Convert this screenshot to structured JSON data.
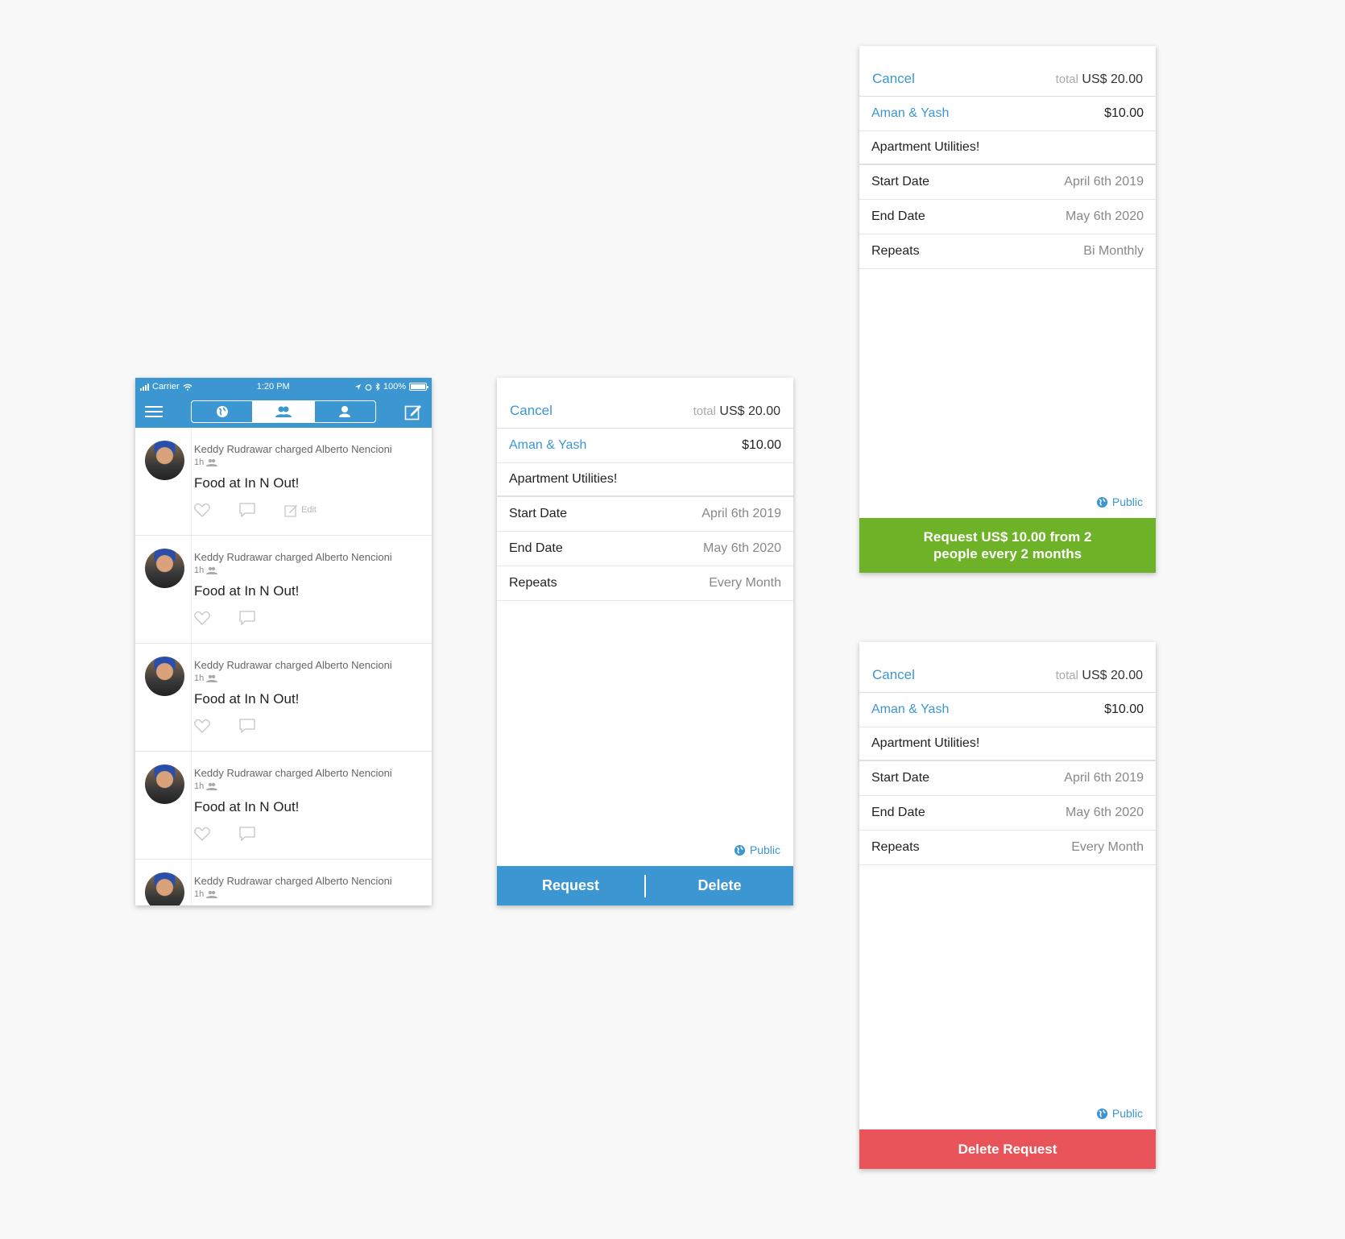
{
  "feed_screen": {
    "status_bar": {
      "carrier": "Carrier",
      "time": "1:20 PM",
      "battery": "100%"
    },
    "tabs": [
      {
        "icon": "globe-icon",
        "active": false
      },
      {
        "icon": "friends-icon",
        "active": true
      },
      {
        "icon": "person-icon",
        "active": false
      }
    ],
    "items": [
      {
        "meta": "Keddy Rudrawar charged Alberto Nencioni",
        "time": "1h",
        "title": "Food at In N Out!",
        "edit": "Edit"
      },
      {
        "meta": "Keddy Rudrawar charged Alberto Nencioni",
        "time": "1h",
        "title": "Food at In N Out!"
      },
      {
        "meta": "Keddy Rudrawar charged Alberto Nencioni",
        "time": "1h",
        "title": "Food at In N Out!"
      },
      {
        "meta": "Keddy Rudrawar charged Alberto Nencioni",
        "time": "1h",
        "title": "Food at In N Out!"
      },
      {
        "meta": "Keddy Rudrawar charged Alberto Nencioni",
        "time": "1h",
        "title": ""
      }
    ]
  },
  "detail_request_delete": {
    "cancel": "Cancel",
    "total_label": "total",
    "total_value": "US$ 20.00",
    "people": "Aman & Yash",
    "amount": "$10.00",
    "memo": "Apartment Utilities!",
    "start_label": "Start Date",
    "start_value": "April 6th 2019",
    "end_label": "End Date",
    "end_value": "May 6th 2020",
    "repeats_label": "Repeats",
    "repeats_value": "Every Month",
    "visibility": "Public",
    "request_button": "Request",
    "delete_button": "Delete"
  },
  "detail_green": {
    "cancel": "Cancel",
    "total_label": "total",
    "total_value": "US$ 20.00",
    "people": "Aman & Yash",
    "amount": "$10.00",
    "memo": "Apartment Utilities!",
    "start_label": "Start Date",
    "start_value": "April 6th 2019",
    "end_label": "End Date",
    "end_value": "May 6th 2020",
    "repeats_label": "Repeats",
    "repeats_value": "Bi Monthly",
    "visibility": "Public",
    "action_button": "Request US$ 10.00 from 2 people every 2 months",
    "action_color": "#6db227"
  },
  "detail_red": {
    "cancel": "Cancel",
    "total_label": "total",
    "total_value": "US$ 20.00",
    "people": "Aman & Yash",
    "amount": "$10.00",
    "memo": "Apartment Utilities!",
    "start_label": "Start Date",
    "start_value": "April 6th 2019",
    "end_label": "End Date",
    "end_value": "May 6th 2020",
    "repeats_label": "Repeats",
    "repeats_value": "Every Month",
    "visibility": "Public",
    "action_button": "Delete Request",
    "action_color": "#e9545a"
  },
  "colors": {
    "accent": "#3c96d2",
    "page_background": "#f8f8f8"
  }
}
